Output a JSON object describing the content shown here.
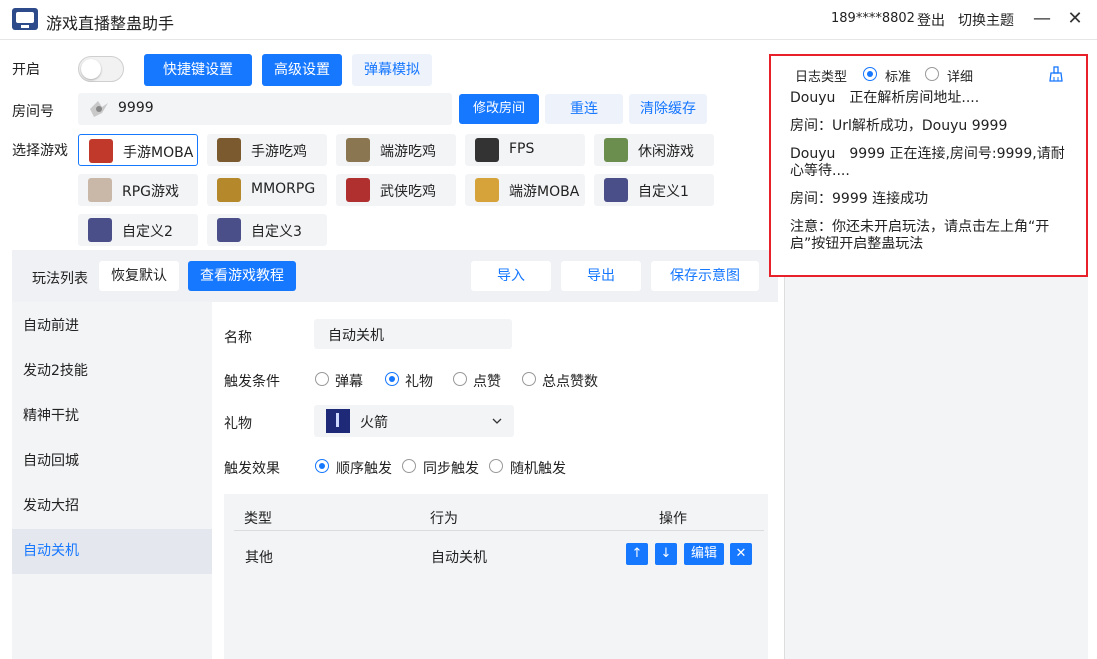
{
  "window": {
    "title": "游戏直播整蛊助手",
    "user_phone": "189****8802",
    "login_label": "登出",
    "theme_label": "切换主题",
    "minimize": "—",
    "close": "✕"
  },
  "controls": {
    "enable_label": "开启",
    "shortcut_btn": "快捷键设置",
    "advanced_btn": "高级设置",
    "danmaku_btn": "弹幕模拟",
    "room_label": "房间号",
    "room_value": "9999",
    "modify_room_btn": "修改房间",
    "reconnect_btn": "重连",
    "clear_cache_btn": "清除缓存",
    "select_game_label": "选择游戏"
  },
  "games": [
    {
      "name": "手游MOBA",
      "color": "#c0392b"
    },
    {
      "name": "手游吃鸡",
      "color": "#7a5a2e"
    },
    {
      "name": "端游吃鸡",
      "color": "#8a7650"
    },
    {
      "name": "FPS",
      "color": "#333333"
    },
    {
      "name": "休闲游戏",
      "color": "#6b8e4e"
    },
    {
      "name": "RPG游戏",
      "color": "#c9b8a8"
    },
    {
      "name": "MMORPG",
      "color": "#b5882b"
    },
    {
      "name": "武侠吃鸡",
      "color": "#b03030"
    },
    {
      "name": "端游MOBA",
      "color": "#d6a33a"
    },
    {
      "name": "自定义1",
      "color": "#4a4f8a"
    },
    {
      "name": "自定义2",
      "color": "#4a4f8a"
    },
    {
      "name": "自定义3",
      "color": "#4a4f8a"
    }
  ],
  "toolbar": {
    "play_list": "玩法列表",
    "restore_default": "恢复默认",
    "view_tutorial": "查看游戏教程",
    "import": "导入",
    "export": "导出",
    "save_diagram": "保存示意图"
  },
  "nav_items": [
    "自动前进",
    "发动2技能",
    "精神干扰",
    "自动回城",
    "发动大招",
    "自动关机"
  ],
  "detail": {
    "name_label": "名称",
    "name_value": "自动关机",
    "trigger_label": "触发条件",
    "trigger_options": [
      "弹幕",
      "礼物",
      "点赞",
      "总点赞数"
    ],
    "gift_label": "礼物",
    "gift_value": "火箭",
    "effect_label": "触发效果",
    "effect_options": [
      "顺序触发",
      "同步触发",
      "随机触发"
    ]
  },
  "table": {
    "headers": [
      "类型",
      "行为",
      "操作"
    ],
    "rows": [
      {
        "type": "其他",
        "action": "自动关机"
      }
    ],
    "ops": {
      "up": "↑",
      "down": "↓",
      "edit": "编辑",
      "delete": "✕"
    }
  },
  "log": {
    "type_label": "日志类型",
    "option_standard": "标准",
    "option_detail": "详细",
    "lines": [
      "Douyu　正在解析房间地址....",
      "房间：Url解析成功，Douyu 9999",
      "Douyu　9999 正在连接,房间号:9999,请耐心等待....",
      "房间：9999 连接成功",
      "注意：你还未开启玩法，请点击左上角“开启”按钮开启整蛊玩法"
    ]
  },
  "colors": {
    "accent": "#1677ff",
    "highlight_border": "#e8202a"
  }
}
